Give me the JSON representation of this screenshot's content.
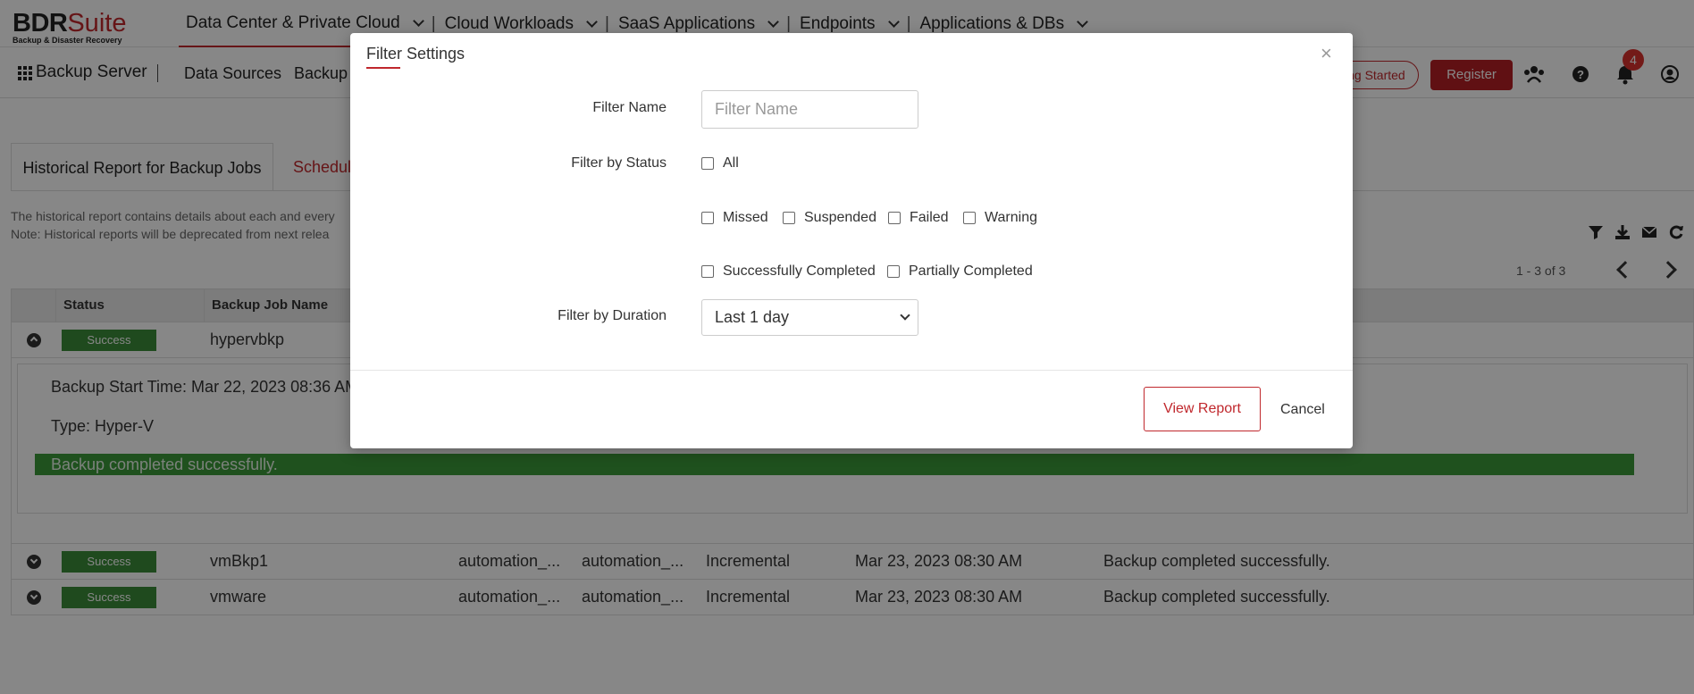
{
  "brand": {
    "name_bold": "BDR",
    "name_light": "Suite",
    "tagline": "Backup & Disaster Recovery"
  },
  "top_menu": [
    "Data Center & Private Cloud",
    "Cloud Workloads",
    "SaaS Applications",
    "Endpoints",
    "Applications & DBs"
  ],
  "sub_nav": {
    "server": "Backup Server",
    "data_sources": "Data Sources",
    "backup": "Backup",
    "getting_started": "ing Started",
    "register": "Register",
    "notification_count": "4"
  },
  "tabs": {
    "active": "Historical Report for Backup Jobs",
    "other": "Schedule"
  },
  "description": {
    "line1": "The historical report contains details about each and every",
    "line2": "Note: Historical reports will be deprecated from next relea"
  },
  "pager": {
    "text": "1 - 3 of 3"
  },
  "table": {
    "headers": [
      "Status",
      "Backup Job Name"
    ],
    "expanded": {
      "status": "Success",
      "name": "hypervbkp",
      "start_time": "Backup Start Time: Mar 22, 2023 08:36 AM",
      "type": "Type: Hyper-V",
      "message": "Backup completed successfully."
    },
    "rows": [
      {
        "status": "Success",
        "name": "vmBkp1",
        "c1": "automation_...",
        "c2": "automation_...",
        "type": "Incremental",
        "time": "Mar 23, 2023 08:30 AM",
        "message": "Backup completed successfully."
      },
      {
        "status": "Success",
        "name": "vmware",
        "c1": "automation_...",
        "c2": "automation_...",
        "type": "Incremental",
        "time": "Mar 23, 2023 08:30 AM",
        "message": "Backup completed successfully."
      }
    ]
  },
  "modal": {
    "title": "Filter Settings",
    "close": "×",
    "filter_name_label": "Filter Name",
    "filter_name_placeholder": "Filter Name",
    "filter_status_label": "Filter by Status",
    "status_options": {
      "all": "All",
      "missed": "Missed",
      "suspended": "Suspended",
      "failed": "Failed",
      "warning": "Warning",
      "successfully_completed": "Successfully Completed",
      "partially_completed": "Partially Completed"
    },
    "filter_duration_label": "Filter by Duration",
    "duration_value": "Last 1 day",
    "view_report": "View Report",
    "cancel": "Cancel"
  },
  "colors": {
    "accent": "#c0282d",
    "success": "#3c8c3a",
    "overlay": "rgba(0,0,0,0.47)"
  }
}
